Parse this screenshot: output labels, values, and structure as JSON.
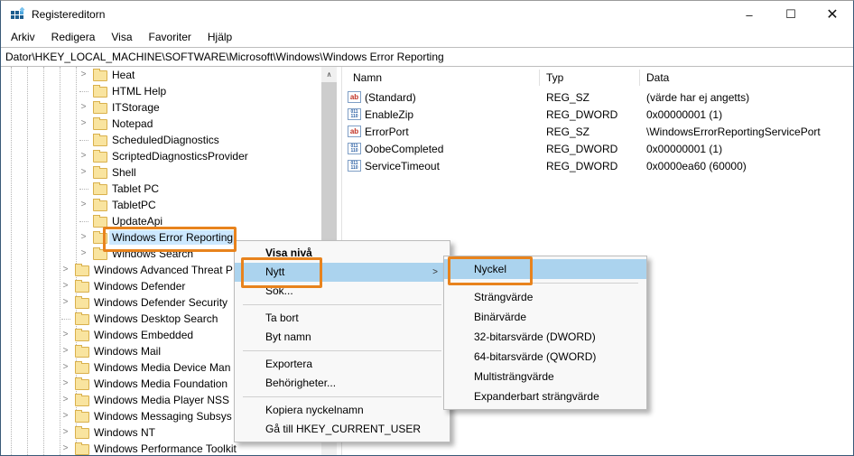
{
  "colors": {
    "accent_border": "#3a5a78",
    "tree_selection": "#cce8ff",
    "menu_highlight": "#abd3ee",
    "annotation_orange": "#e8831d",
    "folder_yellow": "#f9e49f"
  },
  "icons": {
    "chevron": ">",
    "submenu_arrow": ">",
    "scroll_up": "∧",
    "string_glyph": "ab",
    "dword_glyph": "011\n110",
    "minimize_glyph": "–",
    "maximize_glyph": "☐",
    "close_glyph": "✕"
  },
  "window": {
    "title": "Registereditorn"
  },
  "menubar": {
    "items": [
      "Arkiv",
      "Redigera",
      "Visa",
      "Favoriter",
      "Hjälp"
    ]
  },
  "addressbar": {
    "path": "Dator\\HKEY_LOCAL_MACHINE\\SOFTWARE\\Microsoft\\Windows\\Windows Error Reporting"
  },
  "tree": {
    "items": [
      {
        "label": "Heat",
        "level": "deep",
        "expander": "chevron"
      },
      {
        "label": "HTML Help",
        "level": "deep",
        "expander": "stub"
      },
      {
        "label": "ITStorage",
        "level": "deep",
        "expander": "chevron"
      },
      {
        "label": "Notepad",
        "level": "deep",
        "expander": "chevron"
      },
      {
        "label": "ScheduledDiagnostics",
        "level": "deep",
        "expander": "stub"
      },
      {
        "label": "ScriptedDiagnosticsProvider",
        "level": "deep",
        "expander": "chevron"
      },
      {
        "label": "Shell",
        "level": "deep",
        "expander": "chevron"
      },
      {
        "label": "Tablet PC",
        "level": "deep",
        "expander": "stub"
      },
      {
        "label": "TabletPC",
        "level": "deep",
        "expander": "chevron"
      },
      {
        "label": "UpdateApi",
        "level": "deep",
        "expander": "stub"
      },
      {
        "label": "Windows Error Reporting",
        "level": "deep",
        "expander": "chevron",
        "selected": true
      },
      {
        "label": "Windows Search",
        "level": "deep",
        "expander": "chevron"
      },
      {
        "label": "Windows Advanced Threat P",
        "level": "shallow",
        "expander": "chevron"
      },
      {
        "label": "Windows Defender",
        "level": "shallow",
        "expander": "chevron"
      },
      {
        "label": "Windows Defender Security",
        "level": "shallow",
        "expander": "chevron"
      },
      {
        "label": "Windows Desktop Search",
        "level": "shallow",
        "expander": "stub"
      },
      {
        "label": "Windows Embedded",
        "level": "shallow",
        "expander": "chevron"
      },
      {
        "label": "Windows Mail",
        "level": "shallow",
        "expander": "chevron"
      },
      {
        "label": "Windows Media Device Man",
        "level": "shallow",
        "expander": "chevron"
      },
      {
        "label": "Windows Media Foundation",
        "level": "shallow",
        "expander": "chevron"
      },
      {
        "label": "Windows Media Player NSS",
        "level": "shallow",
        "expander": "chevron"
      },
      {
        "label": "Windows Messaging Subsys",
        "level": "shallow",
        "expander": "chevron"
      },
      {
        "label": "Windows NT",
        "level": "shallow",
        "expander": "chevron"
      },
      {
        "label": "Windows Performance Toolkit",
        "level": "shallow",
        "expander": "chevron"
      }
    ]
  },
  "list": {
    "columns": [
      "Namn",
      "Typ",
      "Data"
    ],
    "rows": [
      {
        "icon": "string",
        "name": "(Standard)",
        "type": "REG_SZ",
        "data": "(värde har ej angetts)"
      },
      {
        "icon": "dword",
        "name": "EnableZip",
        "type": "REG_DWORD",
        "data": "0x00000001 (1)"
      },
      {
        "icon": "string",
        "name": "ErrorPort",
        "type": "REG_SZ",
        "data": "\\WindowsErrorReportingServicePort"
      },
      {
        "icon": "dword",
        "name": "OobeCompleted",
        "type": "REG_DWORD",
        "data": "0x00000001 (1)"
      },
      {
        "icon": "dword",
        "name": "ServiceTimeout",
        "type": "REG_DWORD",
        "data": "0x0000ea60 (60000)"
      }
    ]
  },
  "context_menu": {
    "items": [
      {
        "type": "item",
        "label": "Visa nivå",
        "bold": true
      },
      {
        "type": "item",
        "label": "Nytt",
        "highlighted": true,
        "has_submenu": true
      },
      {
        "type": "item",
        "label": "Sök..."
      },
      {
        "type": "separator"
      },
      {
        "type": "item",
        "label": "Ta bort"
      },
      {
        "type": "item",
        "label": "Byt namn"
      },
      {
        "type": "separator"
      },
      {
        "type": "item",
        "label": "Exportera"
      },
      {
        "type": "item",
        "label": "Behörigheter..."
      },
      {
        "type": "separator"
      },
      {
        "type": "item",
        "label": "Kopiera nyckelnamn"
      },
      {
        "type": "item",
        "label": "Gå till HKEY_CURRENT_USER"
      }
    ]
  },
  "submenu": {
    "items": [
      {
        "type": "item",
        "label": "Nyckel",
        "highlighted": true
      },
      {
        "type": "separator"
      },
      {
        "type": "item",
        "label": "Strängvärde"
      },
      {
        "type": "item",
        "label": "Binärvärde"
      },
      {
        "type": "item",
        "label": "32-bitarsvärde (DWORD)"
      },
      {
        "type": "item",
        "label": "64-bitarsvärde (QWORD)"
      },
      {
        "type": "item",
        "label": "Multisträngvärde"
      },
      {
        "type": "item",
        "label": "Expanderbart strängvärde"
      }
    ]
  }
}
